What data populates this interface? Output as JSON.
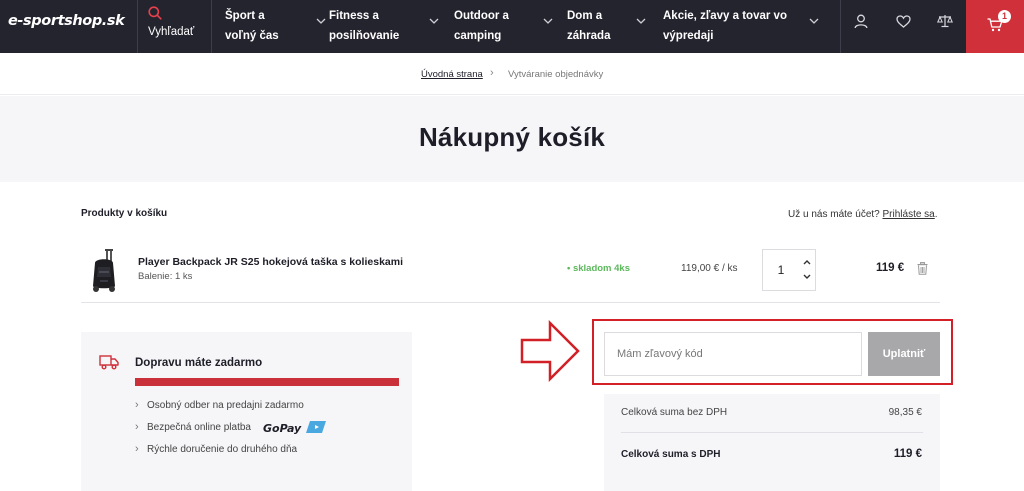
{
  "header": {
    "logo": "e-sportshop.sk",
    "search_label": "Vyhľadať",
    "nav": [
      {
        "label": "Šport a voľný čas"
      },
      {
        "label": "Fitness a posilňovanie"
      },
      {
        "label": "Outdoor a camping"
      },
      {
        "label": "Dom a záhrada"
      },
      {
        "label": "Akcie, zľavy a tovar vo výpredaji"
      }
    ],
    "icons": [
      "user-icon",
      "heart-icon",
      "scales-icon",
      "cart-icon"
    ],
    "cart_count": "1",
    "cart_bg": "#d0303a",
    "bg": "#24242f"
  },
  "breadcrumb": {
    "home": "Úvodná strana",
    "separator": "›",
    "current": "Vytváranie objednávky"
  },
  "page_title": "Nákupný košík",
  "cart": {
    "section_heading": "Produkty v košíku",
    "login_prompt": "Už u nás máte účet?",
    "login_link": "Prihláste sa",
    "login_suffix": ".",
    "items": [
      {
        "name": "Player Backpack JR S25 hokejová taška s kolieskami",
        "packaging": "Balenie: 1 ks",
        "stock": "• skladom 4ks",
        "unit_price": "119,00 € / ks",
        "quantity": "1",
        "total": "119 €"
      }
    ]
  },
  "shipping": {
    "title": "Dopravu máte zadarmo",
    "progress": 1.0,
    "bar_color": "#c9303a",
    "benefits": [
      "Osobný odber na predajni zadarmo",
      "Bezpečná online platba",
      "Rýchle doručenie do druhého dňa"
    ],
    "payment_logo_text": "GoPay"
  },
  "discount": {
    "placeholder": "Mám zľavový kód",
    "button": "Uplatniť",
    "highlight_color": "#d32027"
  },
  "totals": {
    "without_vat_label": "Celková suma bez DPH",
    "without_vat_value": "98,35 €",
    "with_vat_label": "Celková suma s DPH",
    "with_vat_value": "119 €"
  }
}
